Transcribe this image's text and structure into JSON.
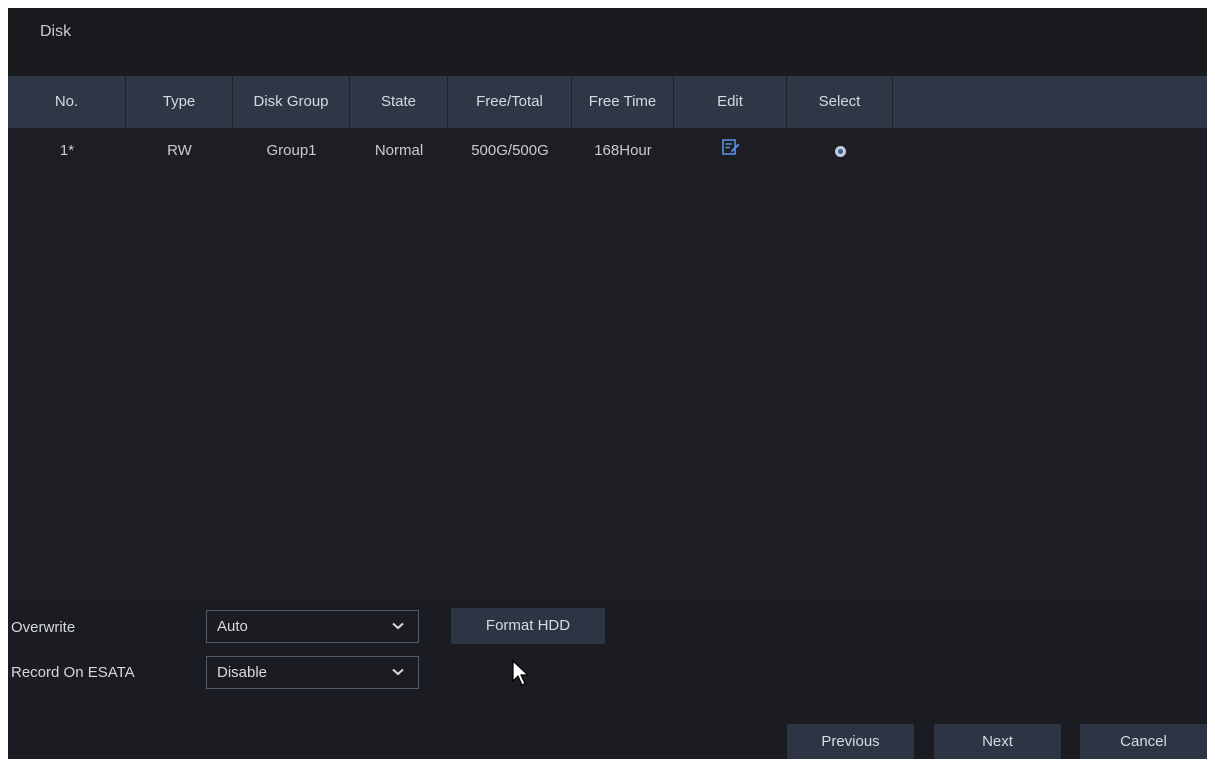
{
  "window": {
    "title": "Disk"
  },
  "table": {
    "columns": [
      "No.",
      "Type",
      "Disk Group",
      "State",
      "Free/Total",
      "Free Time",
      "Edit",
      "Select"
    ],
    "rows": [
      {
        "no": "1*",
        "type": "RW",
        "disk_group": "Group1",
        "state": "Normal",
        "free_total": "500G/500G",
        "free_time": "168Hour",
        "edit_icon": "edit-icon",
        "select_icon": "radio-selected-icon"
      }
    ]
  },
  "settings": {
    "overwrite": {
      "label": "Overwrite",
      "value": "Auto"
    },
    "record_esata": {
      "label": "Record On ESATA",
      "value": "Disable"
    },
    "format_button": "Format HDD"
  },
  "footer": {
    "previous": "Previous",
    "next": "Next",
    "cancel": "Cancel"
  },
  "colors": {
    "background": "#1b1c21",
    "header_bar": "#2f3746",
    "button": "#2d3444",
    "text": "#d4d7dc"
  }
}
